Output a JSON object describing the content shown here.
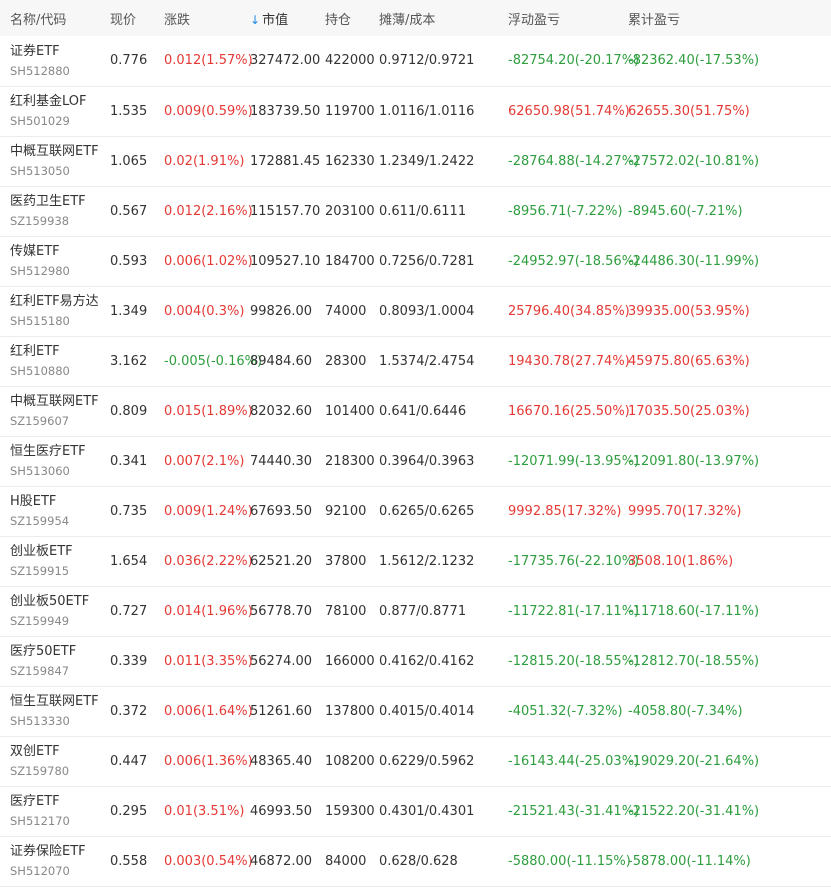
{
  "headers": {
    "name_code": "名称/代码",
    "price": "现价",
    "change": "涨跌",
    "market_value": "市值",
    "sort_arrow": "↓",
    "holding": "持仓",
    "cost": "摊薄/成本",
    "float_pl": "浮动盈亏",
    "total_pl": "累计盈亏"
  },
  "colors": {
    "up": "#e53935",
    "down": "#2e9e3e",
    "accent": "#1e88e5"
  },
  "rows": [
    {
      "name": "证券ETF",
      "code": "SH512880",
      "price": "0.776",
      "change": "0.012(1.57%)",
      "change_dir": "up",
      "mv": "327472.00",
      "hold": "422000",
      "cost": "0.9712/0.9721",
      "fpl": "-82754.20(-20.17%)",
      "fpl_dir": "down",
      "tpl": "-82362.40(-17.53%)",
      "tpl_dir": "down"
    },
    {
      "name": "红利基金LOF",
      "code": "SH501029",
      "price": "1.535",
      "change": "0.009(0.59%)",
      "change_dir": "up",
      "mv": "183739.50",
      "hold": "119700",
      "cost": "1.0116/1.0116",
      "fpl": "62650.98(51.74%)",
      "fpl_dir": "up",
      "tpl": "62655.30(51.75%)",
      "tpl_dir": "up"
    },
    {
      "name": "中概互联网ETF",
      "code": "SH513050",
      "price": "1.065",
      "change": "0.02(1.91%)",
      "change_dir": "up",
      "mv": "172881.45",
      "hold": "162330",
      "cost": "1.2349/1.2422",
      "fpl": "-28764.88(-14.27%)",
      "fpl_dir": "down",
      "tpl": "-27572.02(-10.81%)",
      "tpl_dir": "down"
    },
    {
      "name": "医药卫生ETF",
      "code": "SZ159938",
      "price": "0.567",
      "change": "0.012(2.16%)",
      "change_dir": "up",
      "mv": "115157.70",
      "hold": "203100",
      "cost": "0.611/0.6111",
      "fpl": "-8956.71(-7.22%)",
      "fpl_dir": "down",
      "tpl": "-8945.60(-7.21%)",
      "tpl_dir": "down"
    },
    {
      "name": "传媒ETF",
      "code": "SH512980",
      "price": "0.593",
      "change": "0.006(1.02%)",
      "change_dir": "up",
      "mv": "109527.10",
      "hold": "184700",
      "cost": "0.7256/0.7281",
      "fpl": "-24952.97(-18.56%)",
      "fpl_dir": "down",
      "tpl": "-24486.30(-11.99%)",
      "tpl_dir": "down"
    },
    {
      "name": "红利ETF易方达",
      "code": "SH515180",
      "price": "1.349",
      "change": "0.004(0.3%)",
      "change_dir": "up",
      "mv": "99826.00",
      "hold": "74000",
      "cost": "0.8093/1.0004",
      "fpl": "25796.40(34.85%)",
      "fpl_dir": "up",
      "tpl": "39935.00(53.95%)",
      "tpl_dir": "up"
    },
    {
      "name": "红利ETF",
      "code": "SH510880",
      "price": "3.162",
      "change": "-0.005(-0.16%)",
      "change_dir": "down",
      "mv": "89484.60",
      "hold": "28300",
      "cost": "1.5374/2.4754",
      "fpl": "19430.78(27.74%)",
      "fpl_dir": "up",
      "tpl": "45975.80(65.63%)",
      "tpl_dir": "up"
    },
    {
      "name": "中概互联网ETF",
      "code": "SZ159607",
      "price": "0.809",
      "change": "0.015(1.89%)",
      "change_dir": "up",
      "mv": "82032.60",
      "hold": "101400",
      "cost": "0.641/0.6446",
      "fpl": "16670.16(25.50%)",
      "fpl_dir": "up",
      "tpl": "17035.50(25.03%)",
      "tpl_dir": "up"
    },
    {
      "name": "恒生医疗ETF",
      "code": "SH513060",
      "price": "0.341",
      "change": "0.007(2.1%)",
      "change_dir": "up",
      "mv": "74440.30",
      "hold": "218300",
      "cost": "0.3964/0.3963",
      "fpl": "-12071.99(-13.95%)",
      "fpl_dir": "down",
      "tpl": "-12091.80(-13.97%)",
      "tpl_dir": "down"
    },
    {
      "name": "H股ETF",
      "code": "SZ159954",
      "price": "0.735",
      "change": "0.009(1.24%)",
      "change_dir": "up",
      "mv": "67693.50",
      "hold": "92100",
      "cost": "0.6265/0.6265",
      "fpl": "9992.85(17.32%)",
      "fpl_dir": "up",
      "tpl": "9995.70(17.32%)",
      "tpl_dir": "up"
    },
    {
      "name": "创业板ETF",
      "code": "SZ159915",
      "price": "1.654",
      "change": "0.036(2.22%)",
      "change_dir": "up",
      "mv": "62521.20",
      "hold": "37800",
      "cost": "1.5612/2.1232",
      "fpl": "-17735.76(-22.10%)",
      "fpl_dir": "down",
      "tpl": "3508.10(1.86%)",
      "tpl_dir": "up"
    },
    {
      "name": "创业板50ETF",
      "code": "SZ159949",
      "price": "0.727",
      "change": "0.014(1.96%)",
      "change_dir": "up",
      "mv": "56778.70",
      "hold": "78100",
      "cost": "0.877/0.8771",
      "fpl": "-11722.81(-17.11%)",
      "fpl_dir": "down",
      "tpl": "-11718.60(-17.11%)",
      "tpl_dir": "down"
    },
    {
      "name": "医疗50ETF",
      "code": "SZ159847",
      "price": "0.339",
      "change": "0.011(3.35%)",
      "change_dir": "up",
      "mv": "56274.00",
      "hold": "166000",
      "cost": "0.4162/0.4162",
      "fpl": "-12815.20(-18.55%)",
      "fpl_dir": "down",
      "tpl": "-12812.70(-18.55%)",
      "tpl_dir": "down"
    },
    {
      "name": "恒生互联网ETF",
      "code": "SH513330",
      "price": "0.372",
      "change": "0.006(1.64%)",
      "change_dir": "up",
      "mv": "51261.60",
      "hold": "137800",
      "cost": "0.4015/0.4014",
      "fpl": "-4051.32(-7.32%)",
      "fpl_dir": "down",
      "tpl": "-4058.80(-7.34%)",
      "tpl_dir": "down"
    },
    {
      "name": "双创ETF",
      "code": "SZ159780",
      "price": "0.447",
      "change": "0.006(1.36%)",
      "change_dir": "up",
      "mv": "48365.40",
      "hold": "108200",
      "cost": "0.6229/0.5962",
      "fpl": "-16143.44(-25.03%)",
      "fpl_dir": "down",
      "tpl": "-19029.20(-21.64%)",
      "tpl_dir": "down"
    },
    {
      "name": "医疗ETF",
      "code": "SH512170",
      "price": "0.295",
      "change": "0.01(3.51%)",
      "change_dir": "up",
      "mv": "46993.50",
      "hold": "159300",
      "cost": "0.4301/0.4301",
      "fpl": "-21521.43(-31.41%)",
      "fpl_dir": "down",
      "tpl": "-21522.20(-31.41%)",
      "tpl_dir": "down"
    },
    {
      "name": "证券保险ETF",
      "code": "SH512070",
      "price": "0.558",
      "change": "0.003(0.54%)",
      "change_dir": "up",
      "mv": "46872.00",
      "hold": "84000",
      "cost": "0.628/0.628",
      "fpl": "-5880.00(-11.15%)",
      "fpl_dir": "down",
      "tpl": "-5878.00(-11.14%)",
      "tpl_dir": "down"
    }
  ]
}
